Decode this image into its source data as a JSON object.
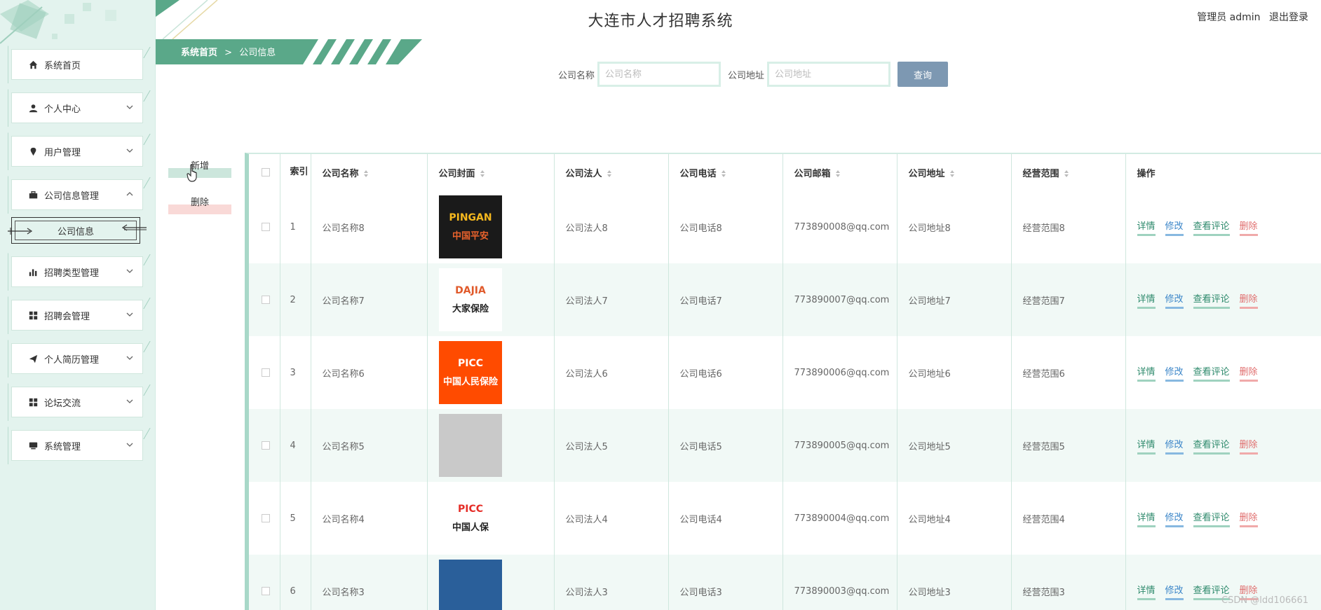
{
  "app_title": "大连市人才招聘系统",
  "header": {
    "role_user": "管理员 admin",
    "logout": "退出登录"
  },
  "breadcrumb": {
    "home": "系统首页",
    "separator": ">",
    "current": "公司信息"
  },
  "sidebar": {
    "items": [
      {
        "label": "系统首页",
        "icon": "home-icon"
      },
      {
        "label": "个人中心",
        "icon": "user-icon"
      },
      {
        "label": "用户管理",
        "icon": "pin-icon"
      },
      {
        "label": "公司信息管理",
        "icon": "briefcase-icon"
      },
      {
        "label": "招聘类型管理",
        "icon": "bar-chart-icon"
      },
      {
        "label": "招聘会管理",
        "icon": "grid-icon"
      },
      {
        "label": "个人简历管理",
        "icon": "paper-plane-icon"
      },
      {
        "label": "论坛交流",
        "icon": "grid-icon"
      },
      {
        "label": "系统管理",
        "icon": "monitor-icon"
      }
    ],
    "active_submenu": "公司信息"
  },
  "search": {
    "company_name_label": "公司名称",
    "company_name_placeholder": "公司名称",
    "company_address_label": "公司地址",
    "company_address_placeholder": "公司地址",
    "query_button": "查询"
  },
  "actions": {
    "add": "新增",
    "delete": "删除"
  },
  "table": {
    "columns": [
      "索引",
      "公司名称",
      "公司封面",
      "公司法人",
      "公司电话",
      "公司邮箱",
      "公司地址",
      "经营范围",
      "操作"
    ],
    "ops": {
      "detail": "详情",
      "edit": "修改",
      "comment": "查看评论",
      "delete": "删除"
    },
    "rows": [
      {
        "index": "1",
        "name": "公司名称8",
        "cover_text": "中国平安",
        "cover_sub": "PINGAN",
        "legal": "公司法人8",
        "phone": "公司电话8",
        "email": "773890008@qq.com",
        "address": "公司地址8",
        "scope": "经营范围8"
      },
      {
        "index": "2",
        "name": "公司名称7",
        "cover_text": "大家保险",
        "cover_sub": "DAJIA",
        "legal": "公司法人7",
        "phone": "公司电话7",
        "email": "773890007@qq.com",
        "address": "公司地址7",
        "scope": "经营范围7"
      },
      {
        "index": "3",
        "name": "公司名称6",
        "cover_text": "中国人民保险",
        "cover_sub": "PICC",
        "legal": "公司法人6",
        "phone": "公司电话6",
        "email": "773890006@qq.com",
        "address": "公司地址6",
        "scope": "经营范围6"
      },
      {
        "index": "4",
        "name": "公司名称5",
        "cover_text": "",
        "cover_sub": "",
        "legal": "公司法人5",
        "phone": "公司电话5",
        "email": "773890005@qq.com",
        "address": "公司地址5",
        "scope": "经营范围5"
      },
      {
        "index": "5",
        "name": "公司名称4",
        "cover_text": "中国人保",
        "cover_sub": "PICC",
        "legal": "公司法人4",
        "phone": "公司电话4",
        "email": "773890004@qq.com",
        "address": "公司地址4",
        "scope": "经营范围4"
      },
      {
        "index": "6",
        "name": "公司名称3",
        "cover_text": "",
        "cover_sub": "",
        "legal": "公司法人3",
        "phone": "公司电话3",
        "email": "773890003@qq.com",
        "address": "公司地址3",
        "scope": "经营范围3"
      }
    ]
  },
  "watermark": "CSDN @ldd106661",
  "colors": {
    "accent": "#5aa889",
    "sidebar_bg": "#e3f3ee",
    "query_btn": "#7d98b2"
  }
}
